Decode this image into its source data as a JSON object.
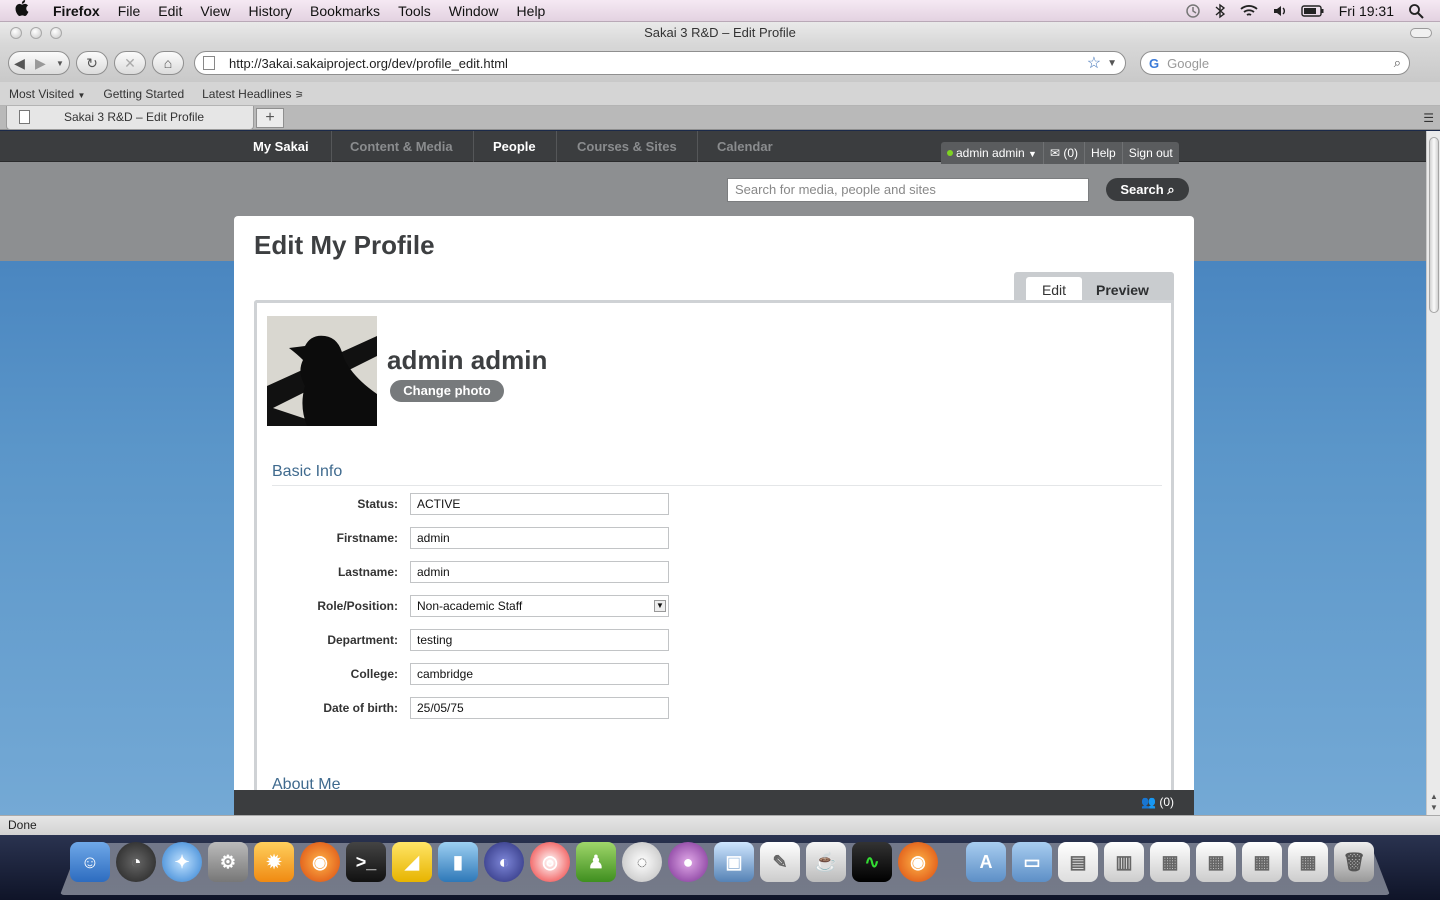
{
  "menubar": {
    "app": "Firefox",
    "items": [
      "File",
      "Edit",
      "View",
      "History",
      "Bookmarks",
      "Tools",
      "Window",
      "Help"
    ],
    "clock": "Fri 19:31"
  },
  "window": {
    "title": "Sakai 3 R&D – Edit Profile"
  },
  "navbar": {
    "url": "http://3akai.sakaiproject.org/dev/profile_edit.html",
    "search_placeholder": "Google"
  },
  "bookmarks": [
    "Most Visited",
    "Getting Started",
    "Latest Headlines"
  ],
  "tabs": {
    "active": "Sakai 3 R&D – Edit Profile",
    "new": "+"
  },
  "sakai": {
    "nav": [
      "My Sakai",
      "Content & Media",
      "People",
      "Courses & Sites",
      "Calendar"
    ],
    "nav_active": [
      "My Sakai",
      "People"
    ],
    "user": "admin admin",
    "messages": "(0)",
    "help": "Help",
    "signout": "Sign out",
    "search_placeholder": "Search for media, people and sites",
    "search_button": "Search",
    "chat_count": "(0)"
  },
  "profile": {
    "heading": "Edit My Profile",
    "tab_edit": "Edit",
    "tab_preview": "Preview",
    "name": "admin admin",
    "change_photo": "Change photo",
    "section_basic": "Basic Info",
    "section_about": "About Me",
    "fields": [
      {
        "label": "Status:",
        "value": "ACTIVE"
      },
      {
        "label": "Firstname:",
        "value": "admin"
      },
      {
        "label": "Lastname:",
        "value": "admin"
      },
      {
        "label": "Role/Position:",
        "value": "Non-academic Staff",
        "type": "select"
      },
      {
        "label": "Department:",
        "value": "testing"
      },
      {
        "label": "College:",
        "value": "cambridge"
      },
      {
        "label": "Date of birth:",
        "value": "25/05/75"
      }
    ]
  },
  "statusbar": {
    "text": "Done"
  },
  "colors": {
    "sakai_nav": "#3b3d3f",
    "page_blue": "#4a86c0",
    "section_heading": "#3f6a8e"
  }
}
